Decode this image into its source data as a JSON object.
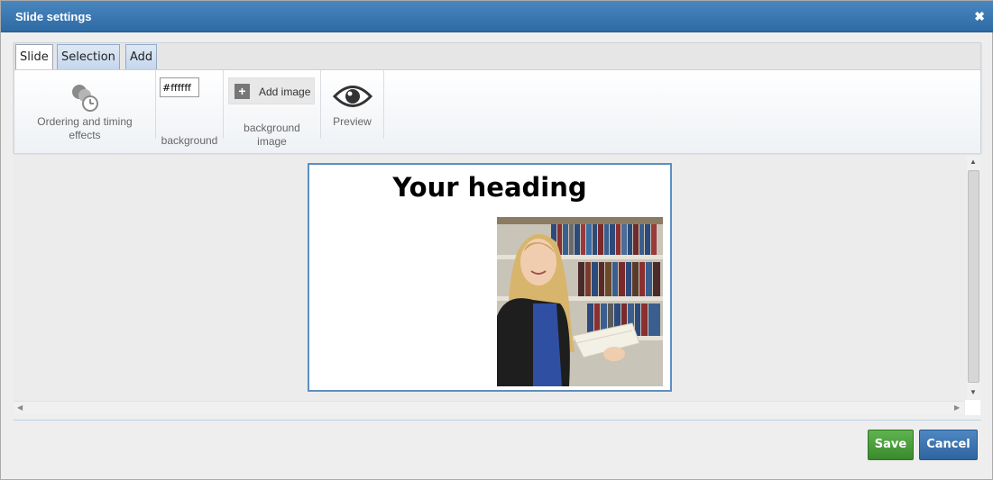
{
  "dialog": {
    "title": "Slide settings",
    "close_label": "✖"
  },
  "tabs": [
    {
      "label": "Slide",
      "active": true
    },
    {
      "label": "Selection",
      "active": false
    },
    {
      "label": "Add",
      "active": false
    }
  ],
  "ribbon": {
    "ordering": {
      "label_line1": "Ordering and timing",
      "label_line2": "effects",
      "icon": "ordering-timing-icon"
    },
    "background": {
      "value": "#ffffff",
      "label": "background"
    },
    "background_image": {
      "button_label": "Add image",
      "label_line1": "background",
      "label_line2": "image"
    },
    "preview": {
      "label": "Preview",
      "icon": "eye-icon"
    }
  },
  "slide": {
    "heading": "Your heading"
  },
  "footer": {
    "save_label": "Save",
    "cancel_label": "Cancel"
  },
  "colors": {
    "titlebar": "#3a77b1",
    "save": "#4a9d3b",
    "cancel": "#3b73b0",
    "slide_border": "#5d8fc2"
  }
}
